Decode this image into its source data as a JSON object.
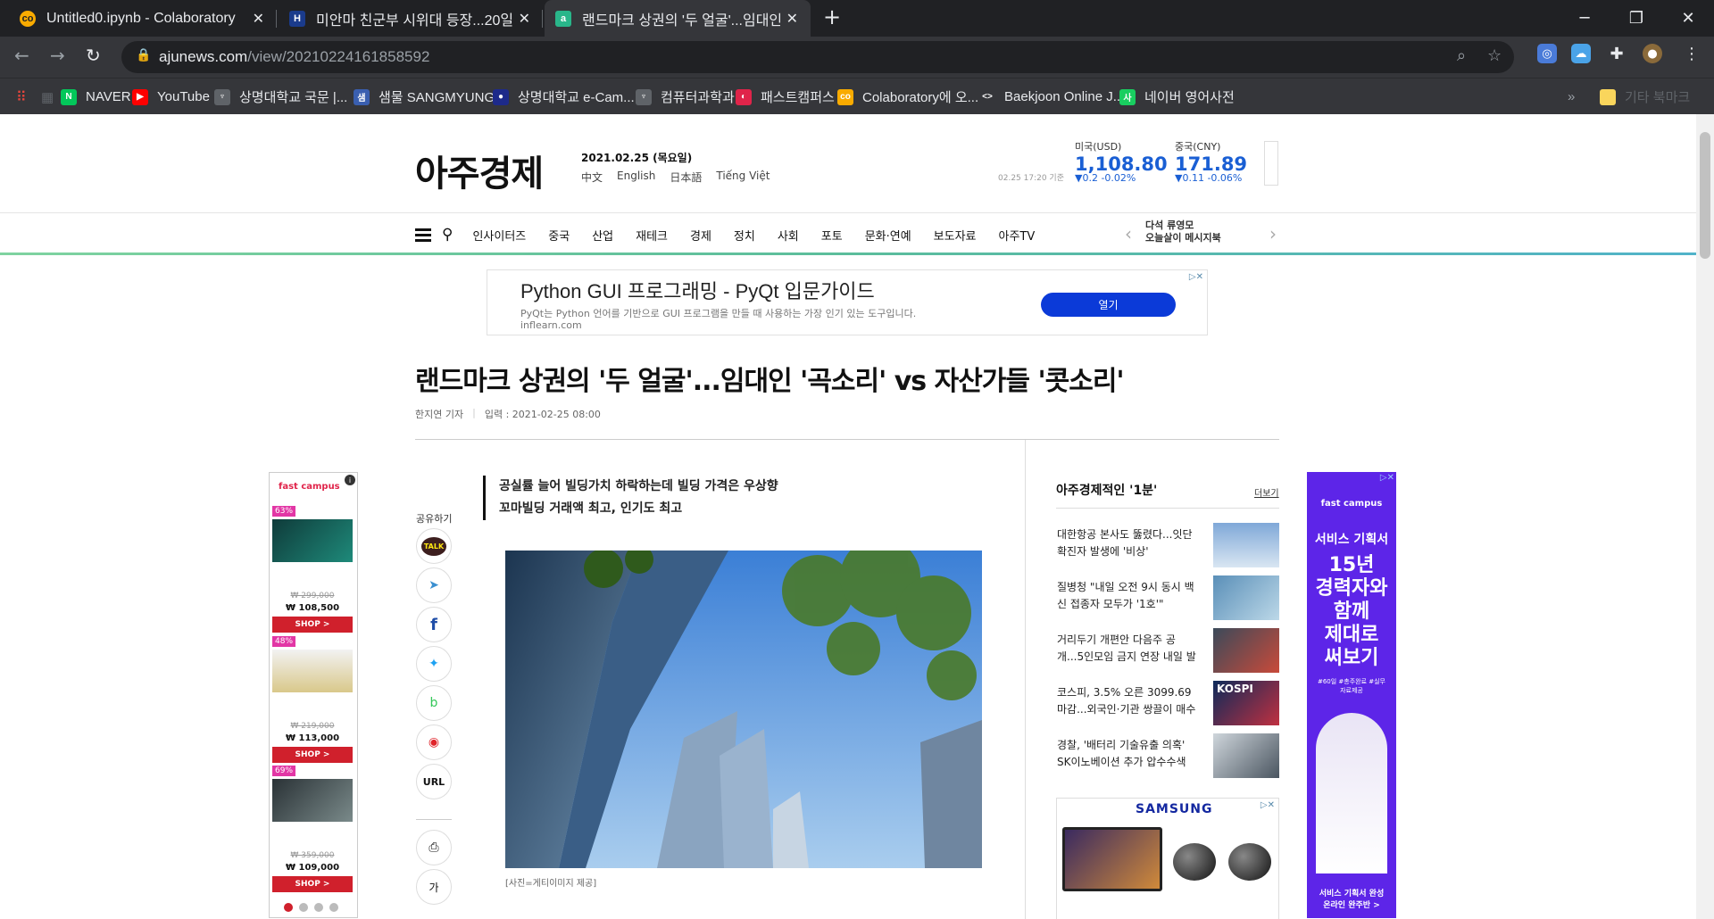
{
  "browser": {
    "tabs": [
      {
        "title": "Untitled0.ipynb - Colaboratory",
        "active": false
      },
      {
        "title": "미안마 친군부 시위대 등장...20일",
        "active": false
      },
      {
        "title": "랜드마크 상권의 '두 얼굴'...임대인",
        "active": true
      }
    ],
    "new_tab": "+",
    "url_host": "ajunews.com",
    "url_path": "/view/20210224161858592",
    "bookmarks": [
      {
        "label": "NAVER",
        "icon": "N",
        "color": "#03c75a"
      },
      {
        "label": "YouTube",
        "icon": "▶",
        "color": "#ff0000"
      },
      {
        "label": "상명대학교 국문 |...",
        "icon": "♆",
        "color": "#5f6368"
      },
      {
        "label": "샘물 SANGMYUNG...",
        "icon": "샘",
        "color": "#3a5fb0"
      },
      {
        "label": "상명대학교 e-Cam...",
        "icon": "●",
        "color": "#1d2a8a"
      },
      {
        "label": "컴퓨터과학과",
        "icon": "♆",
        "color": "#5f6368"
      },
      {
        "label": "패스트캠퍼스",
        "icon": "◐",
        "color": "#e0244a"
      },
      {
        "label": "Colaboratory에 오...",
        "icon": "co",
        "color": "#f9ab00"
      },
      {
        "label": "Baekjoon Online J...",
        "icon": "<>",
        "color": "#35363a"
      },
      {
        "label": "네이버 영어사전",
        "icon": "사",
        "color": "#19ce60"
      }
    ],
    "bookmarks_more": "»",
    "other_bookmarks": "기타 북마크"
  },
  "site": {
    "logo": "아주경제",
    "date": "2021.02.25 (목요일)",
    "langs": [
      "中文",
      "English",
      "日本語",
      "Tiếng Việt"
    ],
    "fx_time": "02.25 17:20 기준",
    "fx": [
      {
        "label": "미국(USD)",
        "value": "1,108.80",
        "change": "▼0.2  -0.02%"
      },
      {
        "label": "중국(CNY)",
        "value": "171.89",
        "change": "▼0.11  -0.06%"
      }
    ],
    "menu": [
      "인사이터즈",
      "중국",
      "산업",
      "재테크",
      "경제",
      "정치",
      "사회",
      "포토",
      "문화·연예",
      "보도자료",
      "아주TV"
    ],
    "promo": "다석 류영모\n오늘살이 메시지북"
  },
  "top_ad": {
    "title": "Python GUI 프로그래밍 - PyQt 입문가이드",
    "desc": "PyQt는 Python 언어를 기반으로 GUI 프로그램을 만들 때 사용하는 가장 인기 있는 도구입니다.",
    "domain": "inflearn.com",
    "button": "열기"
  },
  "article": {
    "headline": "랜드마크 상권의 '두 얼굴'...임대인 '곡소리' vs 자산가들 '콧소리'",
    "author": "한지연 기자",
    "published": "입력 : 2021-02-25 08:00",
    "summary": [
      "공실률 늘어 빌딩가치 하락하는데 빌딩 가격은 우상향",
      "꼬마빌딩 거래액 최고, 인기도 최고"
    ],
    "caption": "[사진=게티이미지 제공]",
    "share_label": "공유하기",
    "share_buttons": [
      "TALK",
      "telegram",
      "f",
      "twitter",
      "band",
      "weibo",
      "URL"
    ],
    "tools": [
      "print",
      "가"
    ]
  },
  "left_ad": {
    "brand": "fast campus",
    "products": [
      {
        "discount": "63%",
        "old": "₩ 299,000",
        "price": "₩ 108,500",
        "cta": "SHOP >"
      },
      {
        "discount": "48%",
        "old": "₩ 219,000",
        "price": "₩ 113,000",
        "cta": "SHOP >"
      },
      {
        "discount": "69%",
        "old": "₩ 359,000",
        "price": "₩ 109,000",
        "cta": "SHOP >"
      }
    ]
  },
  "sidebar": {
    "title": "아주경제적인 '1분'",
    "more": "더보기",
    "news": [
      "대한항공 본사도 뚫렸다...잇단 확진자 발생에 '비상'",
      "질병청 \"내일 오전 9시 동시 백신 접종자 모두가 '1호'\"",
      "거리두기 개편안 다음주 공개...5인모임 금지 연장 내일 발표",
      "코스피, 3.5% 오른 3099.69 마감...외국인·기관 쌍끌이 매수",
      "경찰, '배터리 기술유출 의혹' SK이노베이션 추가 압수수색"
    ],
    "samsung_ad": "SAMSUNG",
    "right_ad": {
      "brand": "fast campus",
      "lines": [
        "서비스 기획서",
        "15년",
        "경력자와",
        "함께",
        "제대로",
        "써보기"
      ],
      "tags": "#60일 #총주완료 #실무자료제공",
      "footer": "서비스 기획서 완성 온라인 완주반 >"
    }
  }
}
